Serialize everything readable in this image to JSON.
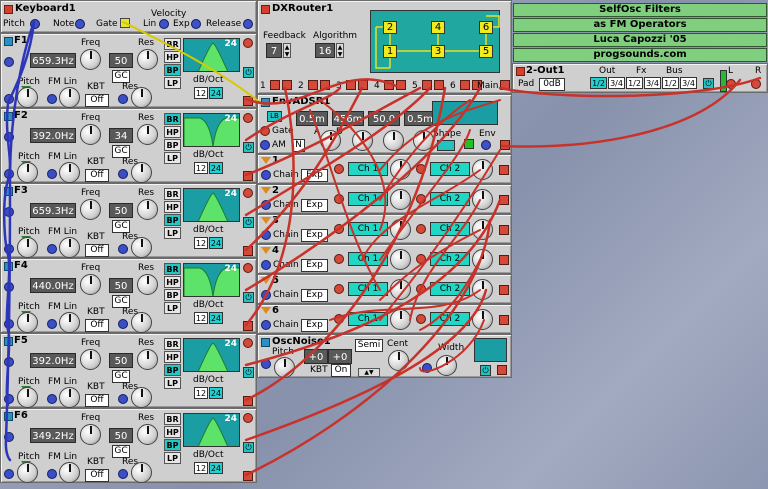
{
  "colors": {
    "module_bg": "#cfcfcf",
    "lcd": "#595959",
    "cyan": "#20d6c4",
    "green_label": "#7fcf7f",
    "cable_red": "#c8322a",
    "cable_blue": "#3038b8",
    "cable_yellow": "#d8c800"
  },
  "keyboard": {
    "title": "Keyboard1",
    "pitch": "Pitch",
    "note": "Note",
    "gate": "Gate",
    "velocity": "Velocity",
    "lin": "Lin",
    "exp": "Exp",
    "release": "Release"
  },
  "filters": [
    {
      "title": "F1",
      "freq_value": "659.3Hz",
      "res_value": "50",
      "gc": "GC",
      "kbt": "Off",
      "graph_value": "24",
      "shape": "bp",
      "on": "BP"
    },
    {
      "title": "F2",
      "freq_value": "392.0Hz",
      "res_value": "34",
      "gc": "GC",
      "kbt": "Off",
      "graph_value": "24",
      "shape": "br",
      "on": "BR"
    },
    {
      "title": "F3",
      "freq_value": "659.3Hz",
      "res_value": "50",
      "gc": "GC",
      "kbt": "Off",
      "graph_value": "24",
      "shape": "bp",
      "on": "BP"
    },
    {
      "title": "F4",
      "freq_value": "440.0Hz",
      "res_value": "50",
      "gc": "GC",
      "kbt": "Off",
      "graph_value": "24",
      "shape": "br",
      "on": "BR"
    },
    {
      "title": "F5",
      "freq_value": "392.0Hz",
      "res_value": "50",
      "gc": "GC",
      "kbt": "Off",
      "graph_value": "24",
      "shape": "bp",
      "on": "BP"
    },
    {
      "title": "F6",
      "freq_value": "349.2Hz",
      "res_value": "50",
      "gc": "GC",
      "kbt": "Off",
      "graph_value": "24",
      "shape": "bp",
      "on": "BP"
    }
  ],
  "filter_labels": {
    "freq": "Freq",
    "res": "Res",
    "pitch": "Pitch",
    "fm_lin": "FM Lin",
    "kbt": "KBT",
    "res2": "Res",
    "dboct": "dB/Oct",
    "s12": "12",
    "s24": "24",
    "br": "BR",
    "hp": "HP",
    "bp": "BP",
    "lp": "LP"
  },
  "dxrouter": {
    "title": "DXRouter1",
    "feedback": "Feedback",
    "feedback_value": "7",
    "algorithm": "Algorithm",
    "algorithm_value": "16",
    "ops": [
      "1",
      "2",
      "3",
      "4",
      "5",
      "6"
    ],
    "main": "Main",
    "cells": [
      "2",
      "4",
      "6",
      "1",
      "3",
      "5"
    ]
  },
  "env": {
    "title": "EnvADSR1",
    "lb": "LB",
    "gate": "Gate",
    "am": "AM",
    "n": "N",
    "a": "A",
    "d": "D",
    "a_val": "0.5m",
    "d_val": "456m",
    "s_val": "50.0",
    "r_val": "0.5m",
    "shape": "Shape",
    "env": "Env"
  },
  "chains": [
    {
      "num": "1",
      "label": "Chain",
      "mode": "Exp",
      "ch1": "Ch 1",
      "ch2": "Ch 2"
    },
    {
      "num": "2",
      "label": "Chain",
      "mode": "Exp",
      "ch1": "Ch 1",
      "ch2": "Ch 2"
    },
    {
      "num": "3",
      "label": "Chain",
      "mode": "Exp",
      "ch1": "Ch 1",
      "ch2": "Ch 2"
    },
    {
      "num": "4",
      "label": "Chain",
      "mode": "Exp",
      "ch1": "Ch 1",
      "ch2": "Ch 2"
    },
    {
      "num": "5",
      "label": "Chain",
      "mode": "Exp",
      "ch1": "Ch 1",
      "ch2": "Ch 2"
    },
    {
      "num": "6",
      "label": "Chain",
      "mode": "Exp",
      "ch1": "Ch 1",
      "ch2": "Ch 2"
    }
  ],
  "oscnoise": {
    "title": "OscNoise1",
    "pitch": "Pitch",
    "semi": "Semi",
    "cent": "Cent",
    "width": "Width",
    "val1": "+0",
    "val2": "+0",
    "kbt": "KBT",
    "kbt_val": "On"
  },
  "notes": [
    "SelfOsc Filters",
    "as FM Operators",
    "Luca Capozzi '05",
    "progsounds.com"
  ],
  "out": {
    "title": "2-Out1",
    "out": "Out",
    "fx": "Fx",
    "bus": "Bus",
    "pad": "Pad",
    "pad_val": "0dB",
    "b1": "1/2",
    "b2": "3/4",
    "b3": "1/2",
    "b4": "3/4",
    "b5": "1/2",
    "b6": "3/4",
    "l": "L",
    "r": "R"
  }
}
